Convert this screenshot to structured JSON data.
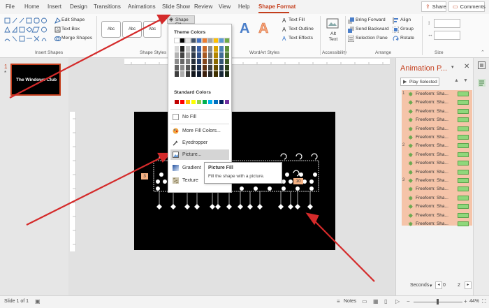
{
  "tabs": [
    {
      "label": "File"
    },
    {
      "label": "Home"
    },
    {
      "label": "Insert"
    },
    {
      "label": "Design"
    },
    {
      "label": "Transitions"
    },
    {
      "label": "Animations"
    },
    {
      "label": "Slide Show"
    },
    {
      "label": "Review"
    },
    {
      "label": "View"
    },
    {
      "label": "Help"
    },
    {
      "label": "Shape Format"
    }
  ],
  "top_buttons": {
    "share": "Share",
    "comments": "Comments"
  },
  "ribbon": {
    "insert_shapes": {
      "edit_shape": "Edit Shape",
      "text_box": "Text Box",
      "merge_shapes": "Merge Shapes",
      "label": "Insert Shapes"
    },
    "shape_styles": {
      "swatch_text": "Abc",
      "shape_fill": "Shape Fill",
      "label": "Shape Styles"
    },
    "wordart": {
      "text_fill": "Text Fill",
      "text_outline": "Text Outline",
      "text_effects": "Text Effects",
      "label": "WordArt Styles"
    },
    "accessibility": {
      "alt_text": "Alt Text",
      "label": "Accessibility"
    },
    "arrange": {
      "bring_forward": "Bring Forward",
      "send_backward": "Send Backward",
      "selection_pane": "Selection Pane",
      "align": "Align",
      "group": "Group",
      "rotate": "Rotate",
      "label": "Arrange"
    },
    "size": {
      "label": "Size"
    }
  },
  "shape_fill_menu": {
    "theme_colors_header": "Theme Colors",
    "standard_colors_header": "Standard Colors",
    "no_fill": "No Fill",
    "more_fill_colors": "More Fill Colors...",
    "eyedropper": "Eyedropper",
    "picture": "Picture...",
    "gradient": "Gradient",
    "texture": "Texture",
    "theme_top": [
      "#ffffff",
      "#000000",
      "#e7e6e6",
      "#44546a",
      "#4472c4",
      "#ed7d31",
      "#a5a5a5",
      "#ffc000",
      "#5b9bd5",
      "#70ad47"
    ],
    "standard": [
      "#c00000",
      "#ff0000",
      "#ffc000",
      "#ffff00",
      "#92d050",
      "#00b050",
      "#00b0f0",
      "#0070c0",
      "#002060",
      "#7030a0"
    ]
  },
  "tooltip": {
    "title": "Picture Fill",
    "body": "Fill the shape with a picture."
  },
  "thumbnail": {
    "number": "1",
    "star": "*",
    "title": "The Windows Club"
  },
  "animation_pane": {
    "title": "Animation P...",
    "play_selected": "Play Selected",
    "items": [
      {
        "num": "1",
        "label": "Freeform: Sha..."
      },
      {
        "num": "",
        "label": "Freeform: Sha..."
      },
      {
        "num": "",
        "label": "Freeform: Sha..."
      },
      {
        "num": "",
        "label": "Freeform: Sha..."
      },
      {
        "num": "",
        "label": "Freeform: Sha..."
      },
      {
        "num": "",
        "label": "Freeform: Sha..."
      },
      {
        "num": "2",
        "label": "Freeform: Sha..."
      },
      {
        "num": "",
        "label": "Freeform: Sha..."
      },
      {
        "num": "",
        "label": "Freeform: Sha..."
      },
      {
        "num": "",
        "label": "Freeform: Sha..."
      },
      {
        "num": "3",
        "label": "Freeform: Sha..."
      },
      {
        "num": "",
        "label": "Freeform: Sha..."
      },
      {
        "num": "",
        "label": "Freeform: Sha..."
      },
      {
        "num": "",
        "label": "Freeform: Sha..."
      },
      {
        "num": "",
        "label": "Freeform: Sha..."
      },
      {
        "num": "",
        "label": "Freeform: Sha..."
      }
    ],
    "seconds_label": "Seconds",
    "seconds_value": "0",
    "seconds_value2": "2"
  },
  "status": {
    "slide": "Slide 1 of 1",
    "notes": "Notes",
    "zoom": "44%"
  },
  "slide_badges": {
    "left": "3",
    "right": "10"
  }
}
